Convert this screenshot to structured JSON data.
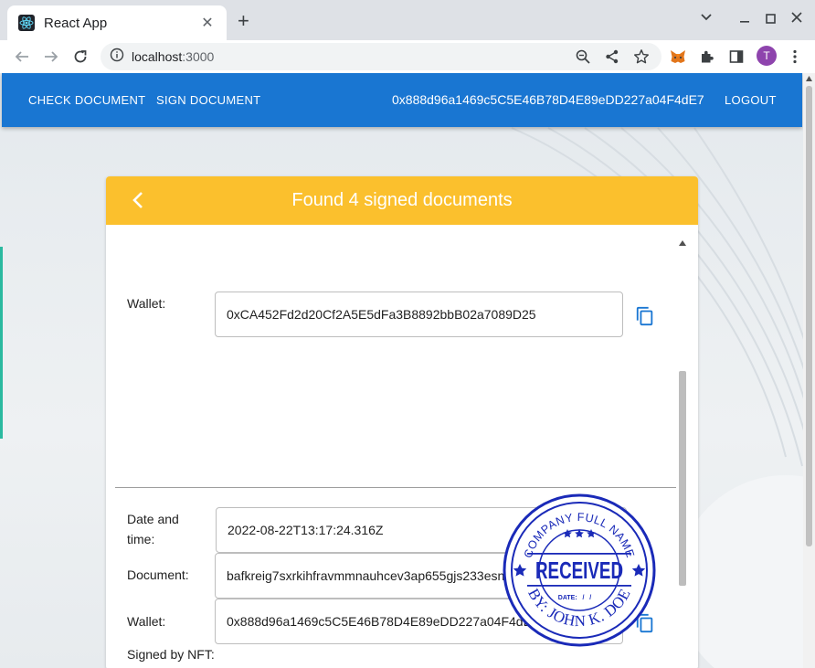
{
  "browser": {
    "tab_title": "React App",
    "url_host": "localhost",
    "url_port": ":3000",
    "profile_initial": "T",
    "icons": [
      "react-favicon",
      "close-icon",
      "plus-icon",
      "chevron-down-icon",
      "minimize-icon",
      "maximize-icon",
      "close-window-icon",
      "back-arrow-icon",
      "forward-arrow-icon",
      "reload-icon",
      "info-icon",
      "zoom-icon",
      "share-icon",
      "star-icon",
      "metamask-icon",
      "extensions-icon",
      "side-panel-icon",
      "more-icon"
    ]
  },
  "appbar": {
    "check_document": "CHECK DOCUMENT",
    "sign_document": "SIGN DOCUMENT",
    "account": "0x888d96a1469c5C5E46B78D4E89eDD227a04F4dE7",
    "logout": "LOGOUT",
    "color": "#1976d2"
  },
  "card": {
    "title": "Found 4 signed documents",
    "header_color": "#fbc02d",
    "prev_entry": {
      "wallet_label": "Wallet:",
      "wallet_value": "0xCA452Fd2d20Cf2A5E5dFa3B8892bbB02a7089D25"
    },
    "entry": {
      "date_label_1": "Date and",
      "date_label_2": "time:",
      "date_value": "2022-08-22T13:17:24.316Z",
      "document_label": "Document:",
      "document_value": "bafkreig7sxrkihfravmmnauhcev3ap655gjs233esntbvhfqrllr7ja3be",
      "wallet_label": "Wallet:",
      "wallet_value": "0x888d96a1469c5C5E46B78D4E89eDD227a04F4dE7",
      "nft_label": "Signed by NFT:"
    },
    "stamp": {
      "top_text": "COMPANY FULL NAME",
      "main_text": "RECEIVED",
      "date_text": "DATE:   /   /",
      "bottom_text": "BY: JOHN K. DOE",
      "color": "#1a2ab8"
    }
  }
}
